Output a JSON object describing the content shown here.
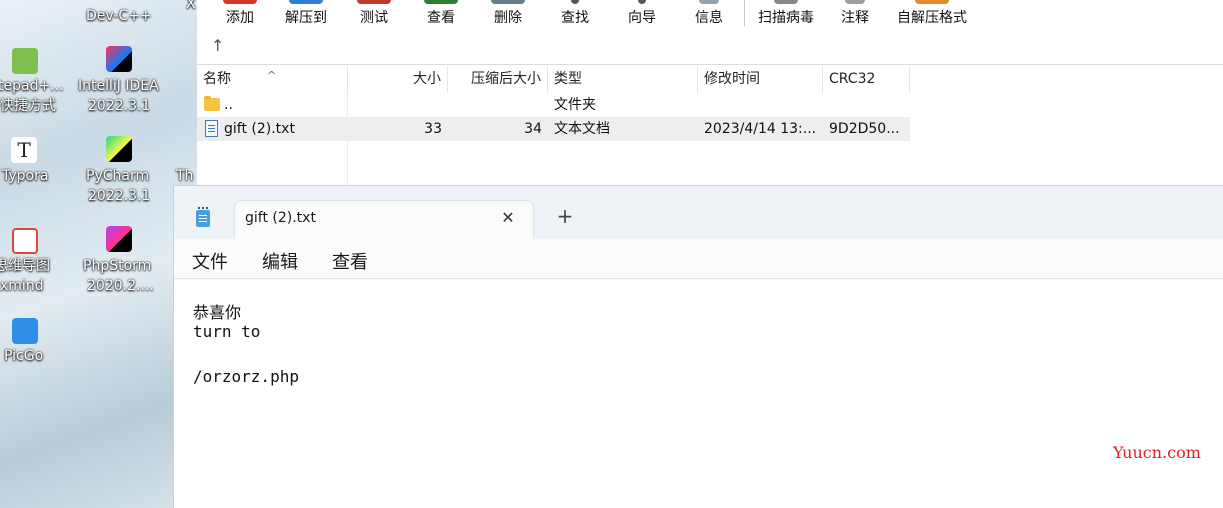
{
  "desktop": {
    "icons": [
      {
        "label_line1": "tepad+...",
        "label_line2": "快捷方式",
        "icon": "notepad-plus-icon"
      },
      {
        "label_line1": "IntelliJ IDEA",
        "label_line2": "2022.3.1",
        "icon": "intellij-idea-icon"
      },
      {
        "label_line1": "Typora",
        "icon": "typora-icon"
      },
      {
        "label_line1": "PyCharm",
        "label_line2": "2022.3.1",
        "icon": "pycharm-icon"
      },
      {
        "label_line1": "思维导图",
        "label_line2": "xmind",
        "icon": "xmind-icon"
      },
      {
        "label_line1": "PhpStorm",
        "label_line2": "2020.2....",
        "icon": "phpstorm-icon"
      },
      {
        "label_line1": "PicGo",
        "icon": "picgo-icon"
      }
    ],
    "top_partial_label": "Dev-C++",
    "partial_label_th": "Th",
    "partial_label_x": "X"
  },
  "archive": {
    "toolbar": {
      "buttons": [
        {
          "label": "添加",
          "color": "#d9342b"
        },
        {
          "label": "解压到",
          "color": "#2f7fd6"
        },
        {
          "label": "测试",
          "color": "#c0392b"
        },
        {
          "label": "查看",
          "color": "#2e7d32"
        },
        {
          "label": "删除",
          "color": "#607d8b"
        },
        {
          "label": "查找",
          "color": "#555555"
        },
        {
          "label": "向导",
          "color": "#555555"
        },
        {
          "label": "信息",
          "color": "#90a4ae"
        },
        {
          "label": "扫描病毒",
          "color": "#888888"
        },
        {
          "label": "注释",
          "color": "#9e9e9e"
        },
        {
          "label": "自解压格式",
          "color": "#e08a2e"
        }
      ],
      "up_arrow": "↑"
    },
    "columns": [
      "名称",
      "大小",
      "压缩后大小",
      "类型",
      "修改时间",
      "CRC32"
    ],
    "rows": [
      {
        "name": "..",
        "size": "",
        "packed": "",
        "type": "文件夹",
        "modified": "",
        "crc": "",
        "icon": "folder-icon"
      },
      {
        "name": "gift (2).txt",
        "size": "33",
        "packed": "34",
        "type": "文本文档",
        "modified": "2023/4/14 13:...",
        "crc": "9D2D50...",
        "icon": "text-file-icon"
      }
    ]
  },
  "notepad": {
    "tab_title": "gift (2).txt",
    "close_glyph": "✕",
    "new_tab_glyph": "+",
    "menu": [
      "文件",
      "编辑",
      "查看"
    ],
    "content_lines": [
      "恭喜你",
      "turn to",
      "",
      "/orzorz.php"
    ],
    "watermark": "Yuucn.com"
  }
}
